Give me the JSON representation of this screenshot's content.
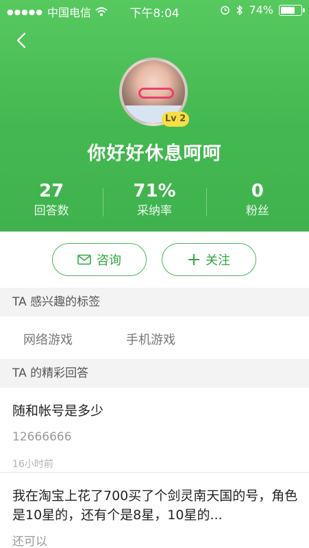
{
  "status_bar": {
    "carrier": "中国电信",
    "time": "下午8:04",
    "battery_percent": "74%",
    "battery_level": 0.74
  },
  "profile": {
    "username": "你好好休息呵呵",
    "level": "Lv 2",
    "stats": [
      {
        "value": "27",
        "label": "回答数"
      },
      {
        "value": "71%",
        "label": "采纳率"
      },
      {
        "value": "0",
        "label": "粉丝"
      }
    ]
  },
  "actions": {
    "consult_label": "咨询",
    "follow_label": "关注"
  },
  "tags_section": {
    "title": "TA 感兴趣的标签",
    "tags": [
      "网络游戏",
      "手机游戏"
    ]
  },
  "answers_section": {
    "title": "TA 的精彩回答",
    "items": [
      {
        "question": "随和帐号是多少",
        "answer": "12666666",
        "time": "16小时前"
      },
      {
        "question": "我在淘宝上花了700买了个剑灵南天国的号，角色是10星的，还有个是8星，10星的...",
        "answer": "还可以",
        "time": ""
      }
    ]
  },
  "colors": {
    "header_green": "#44b850",
    "accent_green": "#2ea83d",
    "level_badge": "#f7de45"
  },
  "icons": [
    "back-chevron-icon",
    "wifi-icon",
    "alarm-icon",
    "bluetooth-icon",
    "battery-icon",
    "mail-icon",
    "plus-icon"
  ]
}
